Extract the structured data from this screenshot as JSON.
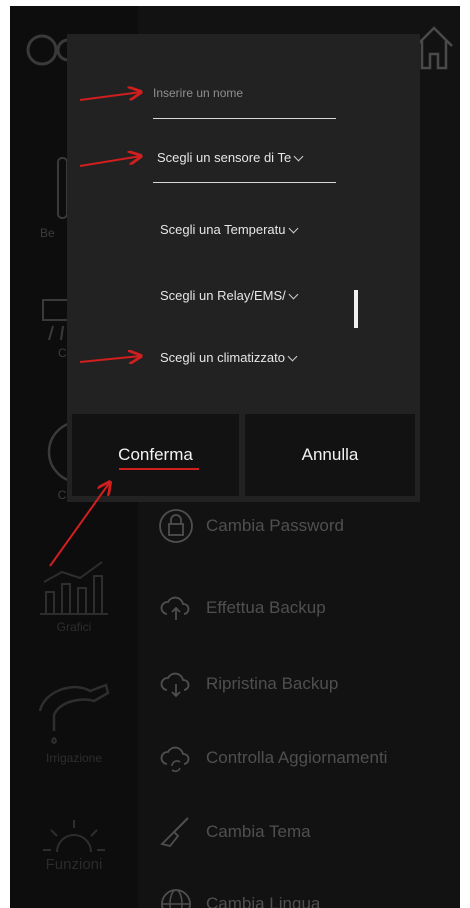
{
  "sidebar": {
    "items": [
      {
        "label": "Be",
        "icon": "radiator-icon"
      },
      {
        "label": "C",
        "icon": "air-conditioner-icon"
      },
      {
        "label": "Crono",
        "icon": "clock-icon"
      },
      {
        "label": "Grafici",
        "icon": "chart-icon"
      },
      {
        "label": "Irrigazione",
        "icon": "faucet-icon"
      },
      {
        "label": "Funzioni",
        "icon": "sun-icon"
      }
    ]
  },
  "menu": {
    "items": [
      {
        "label": "Cambia Password",
        "icon": "lock-icon"
      },
      {
        "label": "Effettua Backup",
        "icon": "cloud-upload-icon"
      },
      {
        "label": "Ripristina Backup",
        "icon": "cloud-download-icon"
      },
      {
        "label": "Controlla Aggiornamenti",
        "icon": "cloud-sync-icon"
      },
      {
        "label": "Cambia Tema",
        "icon": "brush-icon"
      },
      {
        "label": "Cambia Lingua",
        "icon": "globe-icon"
      }
    ]
  },
  "dialog": {
    "name_placeholder": "Inserire un nome",
    "sensor_select": "Scegli un sensore di Te",
    "temperature_select": "Scegli una Temperatu",
    "relay_select": "Scegli un Relay/EMS/",
    "climate_select": "Scegli un climatizzato",
    "confirm_label": "Conferma",
    "cancel_label": "Annulla"
  },
  "colors": {
    "annotation_red": "#d11e1e",
    "dialog_bg": "#222222",
    "app_bg": "#121212"
  }
}
